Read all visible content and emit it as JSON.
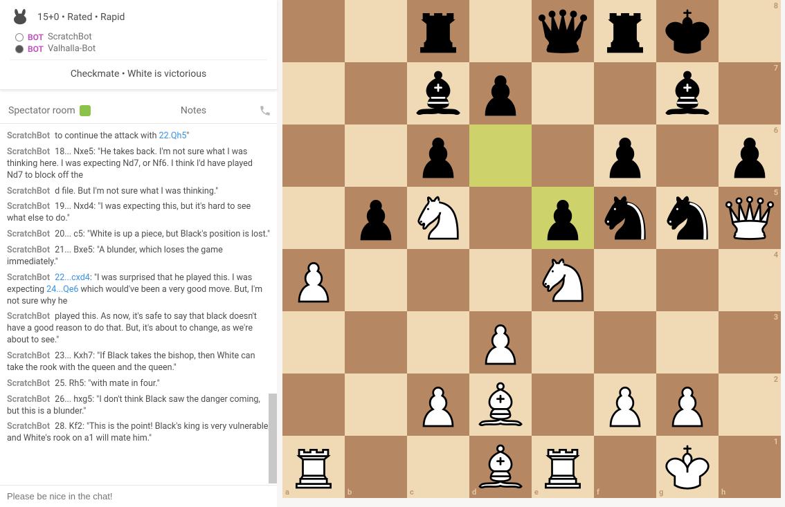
{
  "header": {
    "title": "15+0 • Rated • Rapid",
    "white_bot": "BOT",
    "white_name": "ScratchBot",
    "black_bot": "BOT",
    "black_name": "Valhalla-Bot",
    "status": "Checkmate • White is victorious"
  },
  "tabs": {
    "spectator": "Spectator room",
    "notes": "Notes"
  },
  "chat": [
    {
      "user": "ScratchBot",
      "pre": "to continue the attack with ",
      "link": "22.Qh5",
      "post": "\""
    },
    {
      "user": "ScratchBot",
      "text": "18... Nxe5: \"He takes back. I'm not sure what I was thinking here. I was expecting Nd7, or Nf6. I think I'd have played Nd7 to block off the"
    },
    {
      "user": "ScratchBot",
      "text": "d file. But I'm not sure what I was thinking.\""
    },
    {
      "user": "ScratchBot",
      "text": "19... Nxd4: \"I was expecting this, but it's hard to see what else to do.\""
    },
    {
      "user": "ScratchBot",
      "text": "20... c5: \"White is up a piece, but Black's position is lost.\""
    },
    {
      "user": "ScratchBot",
      "text": "21... Bxe5: \"A blunder, which loses the game immediately.\""
    },
    {
      "user": "ScratchBot",
      "pre": "",
      "link": "22...cxd4",
      "post": ": \"I was surprised that he played this. I was expecting ",
      "link2": "24...Qe6",
      "post2": " which would've been a very good move. But, I'm not sure why he"
    },
    {
      "user": "ScratchBot",
      "text": "played this. As now, it's safe to say that black doesn't have a good reason to do that. But, it's about to change, as we're about to see.\""
    },
    {
      "user": "ScratchBot",
      "text": "23... Kxh7: \"If Black takes the bishop, then White can take the rook with the queen and the queen.\""
    },
    {
      "user": "ScratchBot",
      "text": "25. Rh5: \"with mate in four.\""
    },
    {
      "user": "ScratchBot",
      "text": "26... hxg5: \"I don't think Black saw the danger coming, but this is a blunder.\""
    },
    {
      "user": "ScratchBot",
      "text": "28. Kf2: \"This is the point! Black's king is very vulnerable, and White's rook on a1 will mate him.\""
    }
  ],
  "chat_placeholder": "Please be nice in the chat!",
  "board": {
    "light": "#f0d9b5",
    "dark": "#b58863",
    "highlight_squares": [
      "d6",
      "e5"
    ],
    "files": [
      "a",
      "b",
      "c",
      "d",
      "e",
      "f",
      "g",
      "h"
    ],
    "ranks": [
      "1",
      "2",
      "3",
      "4",
      "5",
      "6",
      "7",
      "8"
    ],
    "pieces": [
      {
        "sq": "c8",
        "p": "r",
        "c": "b"
      },
      {
        "sq": "e8",
        "p": "q",
        "c": "b"
      },
      {
        "sq": "f8",
        "p": "r",
        "c": "b"
      },
      {
        "sq": "g8",
        "p": "k",
        "c": "b"
      },
      {
        "sq": "c7",
        "p": "b",
        "c": "b"
      },
      {
        "sq": "d7",
        "p": "p",
        "c": "b"
      },
      {
        "sq": "g7",
        "p": "b",
        "c": "b"
      },
      {
        "sq": "c6",
        "p": "p",
        "c": "b"
      },
      {
        "sq": "f6",
        "p": "p",
        "c": "b"
      },
      {
        "sq": "h6",
        "p": "p",
        "c": "b"
      },
      {
        "sq": "b5",
        "p": "p",
        "c": "b"
      },
      {
        "sq": "c5",
        "p": "n",
        "c": "w"
      },
      {
        "sq": "e5",
        "p": "p",
        "c": "b"
      },
      {
        "sq": "f5",
        "p": "n",
        "c": "b"
      },
      {
        "sq": "g5",
        "p": "n",
        "c": "b"
      },
      {
        "sq": "h5",
        "p": "q",
        "c": "w"
      },
      {
        "sq": "a4",
        "p": "p",
        "c": "w"
      },
      {
        "sq": "e4",
        "p": "n",
        "c": "w"
      },
      {
        "sq": "d3",
        "p": "p",
        "c": "w"
      },
      {
        "sq": "c2",
        "p": "p",
        "c": "w"
      },
      {
        "sq": "d2",
        "p": "b",
        "c": "w"
      },
      {
        "sq": "f2",
        "p": "p",
        "c": "w"
      },
      {
        "sq": "g2",
        "p": "p",
        "c": "w"
      },
      {
        "sq": "a1",
        "p": "r",
        "c": "w"
      },
      {
        "sq": "d1",
        "p": "b",
        "c": "w"
      },
      {
        "sq": "e1",
        "p": "r",
        "c": "w"
      },
      {
        "sq": "g1",
        "p": "k",
        "c": "w"
      }
    ]
  }
}
